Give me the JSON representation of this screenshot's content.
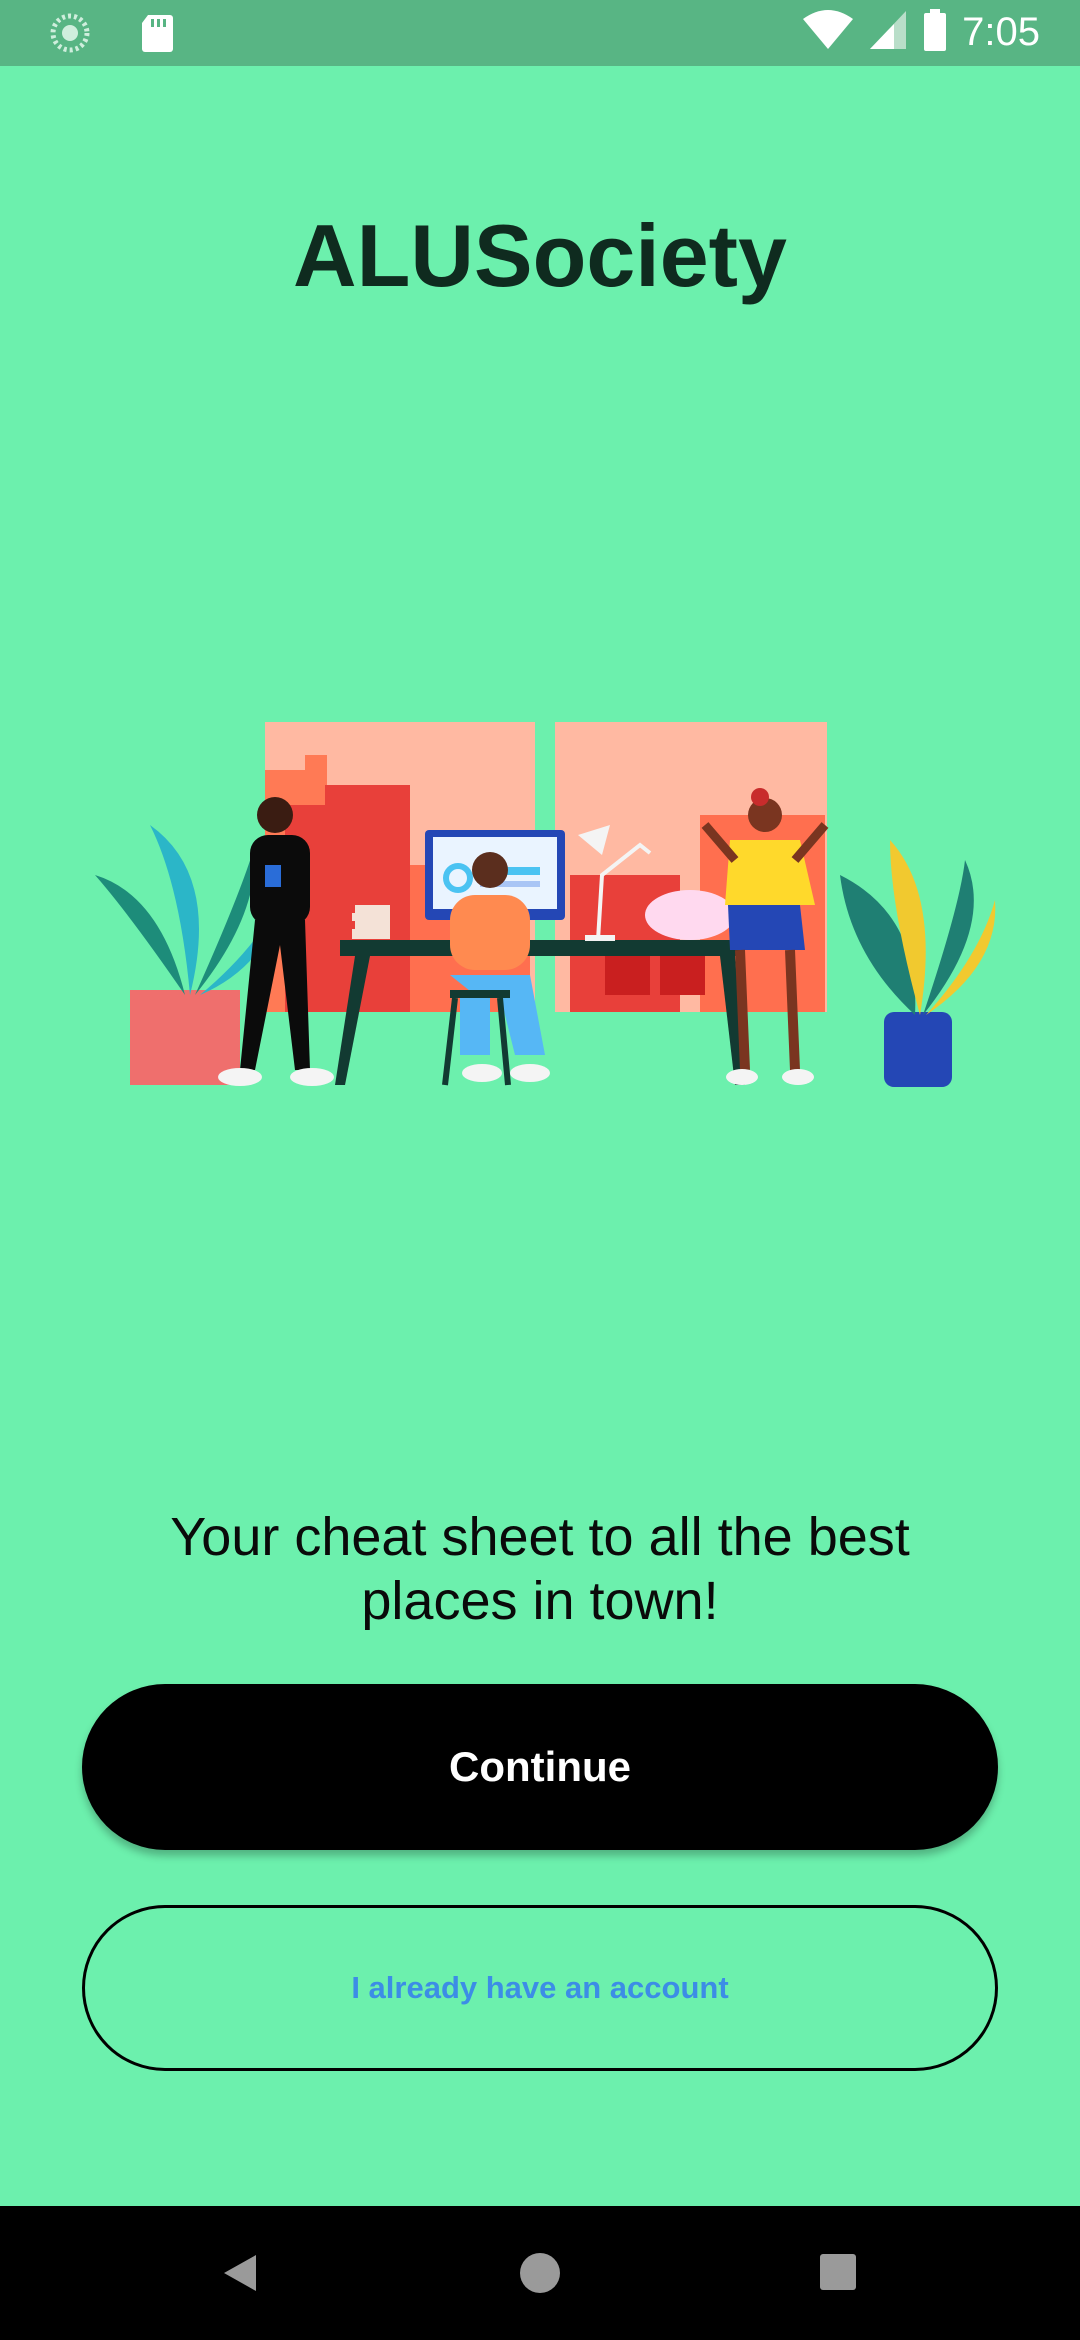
{
  "status_bar": {
    "time": "7:05",
    "icons": [
      "loading-icon",
      "sd-card-icon",
      "wifi-icon",
      "signal-icon",
      "battery-icon"
    ]
  },
  "app": {
    "title": "ALUSociety",
    "tagline_line1": "Your cheat sheet to all the best",
    "tagline_line2": "places in town!"
  },
  "illustration": {
    "description_icon": "office-people-illustration"
  },
  "buttons": {
    "continue_label": "Continue",
    "account_label": "I already have an account"
  },
  "nav_bar": {
    "icons": [
      "back-icon",
      "home-icon",
      "recents-icon"
    ]
  },
  "colors": {
    "background": "#6cf0ad",
    "status_bar": "#58b584",
    "primary_button": "#000000",
    "link_text": "#3c8de6"
  }
}
